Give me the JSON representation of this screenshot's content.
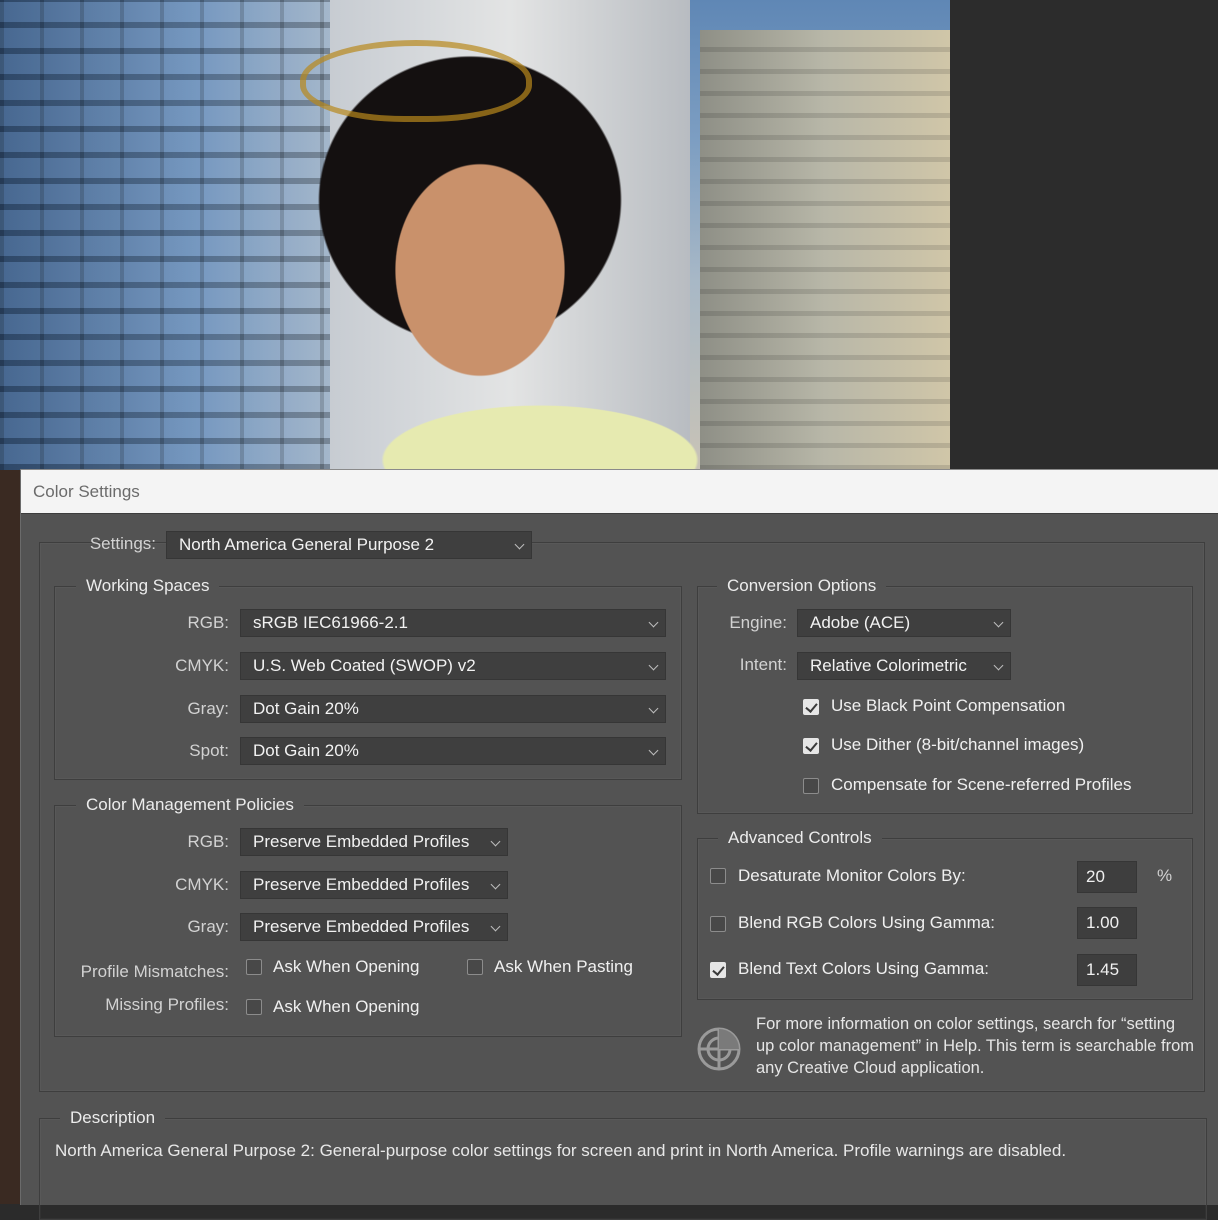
{
  "dialog": {
    "title": "Color Settings"
  },
  "settings": {
    "label": "Settings:",
    "value": "North America General Purpose 2"
  },
  "working_spaces": {
    "title": "Working Spaces",
    "rgb": {
      "label": "RGB:",
      "value": "sRGB IEC61966-2.1"
    },
    "cmyk": {
      "label": "CMYK:",
      "value": "U.S. Web Coated (SWOP) v2"
    },
    "gray": {
      "label": "Gray:",
      "value": "Dot Gain 20%"
    },
    "spot": {
      "label": "Spot:",
      "value": "Dot Gain 20%"
    }
  },
  "policies": {
    "title": "Color Management Policies",
    "rgb": {
      "label": "RGB:",
      "value": "Preserve Embedded Profiles"
    },
    "cmyk": {
      "label": "CMYK:",
      "value": "Preserve Embedded Profiles"
    },
    "gray": {
      "label": "Gray:",
      "value": "Preserve Embedded Profiles"
    },
    "mismatches": {
      "label": "Profile Mismatches:",
      "ask_opening": "Ask When Opening",
      "ask_pasting": "Ask When Pasting",
      "ask_opening_checked": false,
      "ask_pasting_checked": false
    },
    "missing": {
      "label": "Missing Profiles:",
      "ask_opening": "Ask When Opening",
      "ask_opening_checked": false
    }
  },
  "conversion": {
    "title": "Conversion Options",
    "engine": {
      "label": "Engine:",
      "value": "Adobe (ACE)"
    },
    "intent": {
      "label": "Intent:",
      "value": "Relative Colorimetric"
    },
    "black_point": {
      "label": "Use Black Point Compensation",
      "checked": true
    },
    "dither": {
      "label": "Use Dither (8-bit/channel images)",
      "checked": true
    },
    "scene_referred": {
      "label": "Compensate for Scene-referred Profiles",
      "checked": false
    }
  },
  "advanced": {
    "title": "Advanced Controls",
    "desaturate": {
      "label": "Desaturate Monitor Colors By:",
      "value": "20",
      "unit": "%",
      "checked": false
    },
    "blend_rgb": {
      "label": "Blend RGB Colors Using Gamma:",
      "value": "1.00",
      "checked": false
    },
    "blend_text": {
      "label": "Blend Text Colors Using Gamma:",
      "value": "1.45",
      "checked": true
    }
  },
  "info": {
    "icon": "color-management-icon",
    "text": "For more information on color settings, search for “setting up color management” in Help. This term is searchable from any Creative Cloud application."
  },
  "description": {
    "title": "Description",
    "text": "North America General Purpose 2:  General-purpose color settings for screen and print in North America. Profile warnings are disabled."
  }
}
